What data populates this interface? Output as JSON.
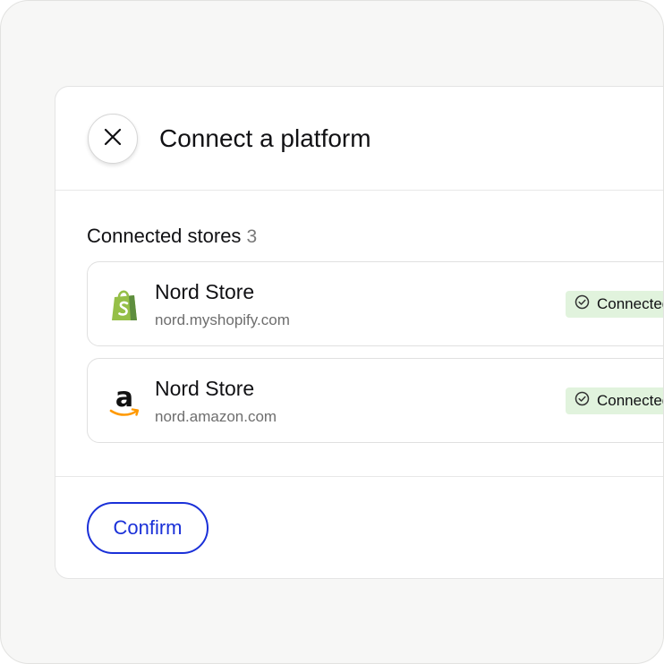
{
  "dialog": {
    "title": "Connect a platform",
    "close_icon": "close-icon"
  },
  "section": {
    "label": "Connected stores",
    "count": "3"
  },
  "stores": [
    {
      "name": "Nord Store",
      "url": "nord.myshopify.com",
      "platform_icon": "shopify-logo-icon",
      "status": "Connected",
      "status_icon": "check-circle-icon"
    },
    {
      "name": "Nord Store",
      "url": "nord.amazon.com",
      "platform_icon": "amazon-logo-icon",
      "status": "Connected",
      "status_icon": "check-circle-icon"
    }
  ],
  "footer": {
    "confirm_label": "Confirm"
  },
  "colors": {
    "accent": "#1a30d8",
    "status_bg": "#e1f3dd",
    "shopify_green": "#95bf47",
    "amazon_orange": "#ff9900"
  }
}
